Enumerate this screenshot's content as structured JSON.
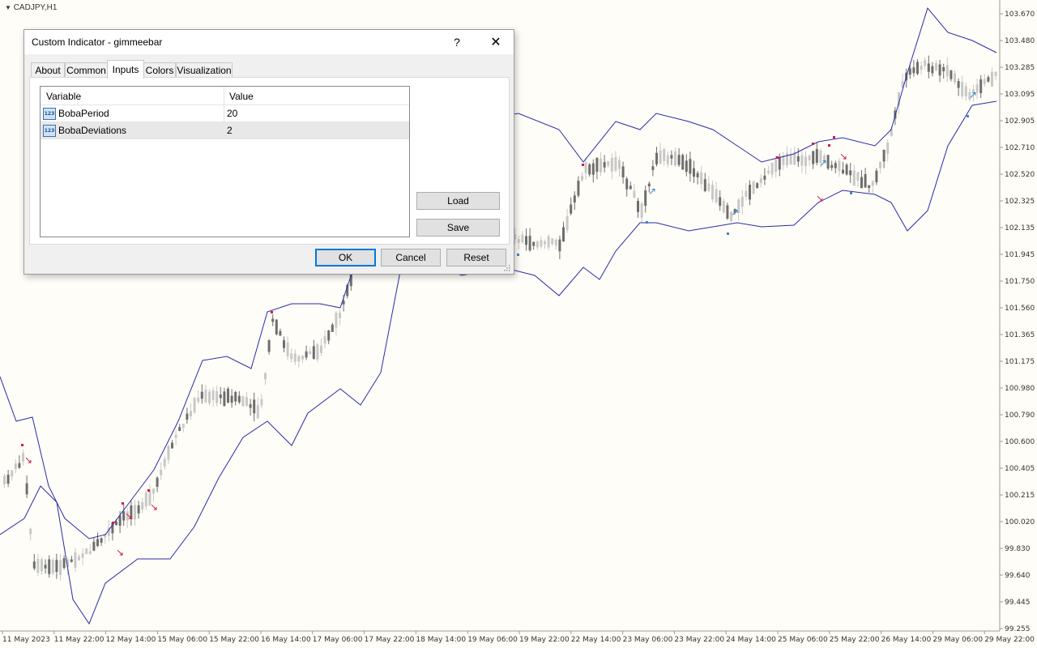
{
  "chart": {
    "symbol": "CADJPY,H1",
    "price_levels": [
      "103.670",
      "103.480",
      "103.285",
      "103.095",
      "102.905",
      "102.710",
      "102.520",
      "102.325",
      "102.135",
      "101.945",
      "101.750",
      "101.560",
      "101.365",
      "101.175",
      "100.980",
      "100.790",
      "100.600",
      "100.405",
      "100.215",
      "100.020",
      "99.830",
      "99.640",
      "99.445",
      "99.255"
    ],
    "time_labels": [
      "11 May 2023",
      "11 May 22:00",
      "12 May 14:00",
      "15 May 06:00",
      "15 May 22:00",
      "16 May 14:00",
      "17 May 06:00",
      "17 May 22:00",
      "18 May 14:00",
      "19 May 06:00",
      "19 May 22:00",
      "22 May 14:00",
      "23 May 06:00",
      "23 May 22:00",
      "24 May 14:00",
      "25 May 06:00",
      "25 May 22:00",
      "26 May 14:00",
      "29 May 06:00",
      "29 May 22:00"
    ],
    "colors": {
      "background": "#fffdf7",
      "band": "#2b2bab",
      "candle_up": "#c8c8c8",
      "candle_down": "#6e6e6e",
      "sell_arrow": "#d4174a",
      "buy_arrow": "#3a86c8"
    }
  },
  "dialog": {
    "title": "Custom Indicator - gimmeebar",
    "help_icon": "?",
    "close_icon": "✕",
    "tabs": [
      "About",
      "Common",
      "Inputs",
      "Colors",
      "Visualization"
    ],
    "active_tab": "Inputs",
    "grid": {
      "headers": [
        "Variable",
        "Value"
      ],
      "rows": [
        {
          "variable": "BobaPeriod",
          "value": "20",
          "icon": "123-icon"
        },
        {
          "variable": "BobaDeviations",
          "value": "2",
          "icon": "123-icon"
        }
      ]
    },
    "load_label": "Load",
    "save_label": "Save",
    "ok_label": "OK",
    "cancel_label": "Cancel",
    "reset_label": "Reset"
  }
}
